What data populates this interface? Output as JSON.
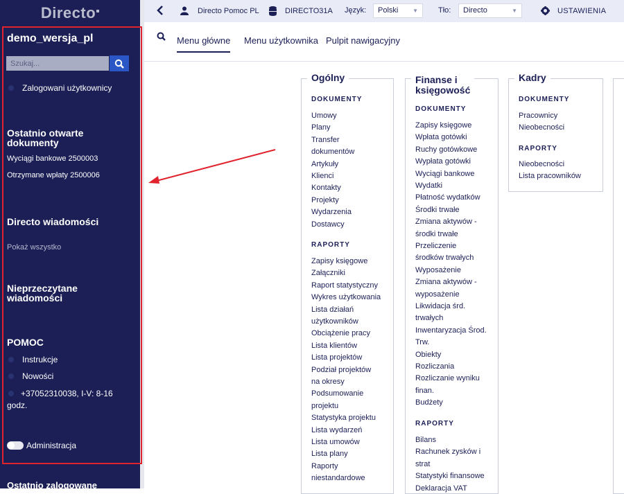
{
  "sidebar": {
    "logo": "Directo",
    "company": "demo_wersja_pl",
    "search_placeholder": "Szukaj...",
    "logged_users": "Zalogowani użytkownicy",
    "recent_heading": "Ostatnio otwarte dokumenty",
    "recent_docs": [
      "Wyciągi bankowe 2500003",
      "Otrzymane wpłaty 2500006"
    ],
    "news_heading": "Directo wiadomości",
    "show_all": "Pokaż wszystko",
    "unread_heading": "Nieprzeczytane wiadomości",
    "help_heading": "POMOC",
    "help_items": [
      "Instrukcje",
      "Nowości",
      "+37052310038, I-V: 8-16 godz."
    ],
    "admin": "Administracja",
    "bottom_cut": "Ostatnio zalogowane"
  },
  "topbar": {
    "user": "Directo Pomoc PL",
    "database": "DIRECTO31A",
    "language_label": "Język:",
    "language_value": "Polski",
    "background_label": "Tło:",
    "background_value": "Directo",
    "settings": "USTAWIENIA"
  },
  "tabs": [
    "Menu główne",
    "Menu użytkownika",
    "Pulpit nawigacyjny"
  ],
  "menu": {
    "general": {
      "title": "Ogólny",
      "docs_heading": "DOKUMENTY",
      "docs": [
        "Umowy",
        "Plany",
        "Transfer",
        "dokumentów",
        "Artykuły",
        "Klienci",
        "Kontakty",
        "Projekty",
        "Wydarzenia",
        "Dostawcy"
      ],
      "reports_heading": "RAPORTY",
      "reports": [
        "Zapisy księgowe",
        "Załączniki",
        "Raport statystyczny",
        "Wykres użytkowania",
        "Lista działań",
        "użytkowników",
        "Obciążenie pracy",
        "Lista klientów",
        "Lista projektów",
        "Podział projektów",
        "na okresy",
        "Podsumowanie",
        "projektu",
        "Statystyka projektu",
        "Lista wydarzeń",
        "Lista umowów",
        "Lista plany",
        "Raporty",
        "niestandardowe"
      ]
    },
    "finance": {
      "title_line1": "Finanse i",
      "title_line2": "księgowość",
      "docs_heading": "DOKUMENTY",
      "docs": [
        "Zapisy księgowe",
        "Wpłata gotówki",
        "Ruchy gotówkowe",
        "Wypłata gotówki",
        "Wyciągi bankowe",
        "Wydatki",
        "Płatność wydatków",
        "Środki trwałe",
        "Zmiana aktywów -",
        "środki trwałe",
        "Przeliczenie",
        "środków trwałych",
        "Wyposażenie",
        "Zmiana aktywów -",
        "wyposażenie",
        "Likwidacja śrd.",
        "trwałych",
        "Inwentaryzacja Środ.",
        "Trw.",
        "Obiekty",
        "Rozliczania",
        "Rozliczanie wyniku",
        "finan.",
        "Budżety"
      ],
      "reports_heading": "RAPORTY",
      "reports": [
        "Bilans",
        "Rachunek zysków i",
        "strat",
        "Statystyki finansowe",
        "Deklaracja VAT"
      ]
    },
    "hr": {
      "title": "Kadry",
      "docs_heading": "DOKUMENTY",
      "docs": [
        "Pracownicy",
        "Nieobecności"
      ],
      "reports_heading": "RAPORTY",
      "reports": [
        "Nieobecności",
        "Lista pracowników"
      ]
    }
  },
  "colors": {
    "sidebar": "#1b1f56",
    "accent": "#2a56c6",
    "annotation": "#e0232d"
  }
}
